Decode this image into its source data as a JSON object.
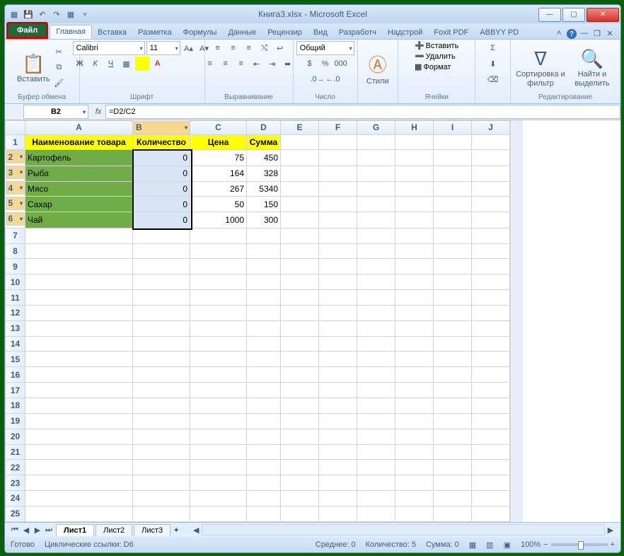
{
  "window": {
    "title": "Книга3.xlsx  -  Microsoft Excel"
  },
  "tabs": {
    "file": "Файл",
    "items": [
      "Главная",
      "Вставка",
      "Разметка",
      "Формулы",
      "Данные",
      "Рецензир",
      "Вид",
      "Разработч",
      "Надстрой",
      "Foxit PDF",
      "ABBYY PD"
    ],
    "active": 0
  },
  "ribbon": {
    "paste": "Вставить",
    "clipboard_group": "Буфер обмена",
    "font_name": "Calibri",
    "font_size": "11",
    "font_group": "Шрифт",
    "align_group": "Выравнивание",
    "number_format": "Общий",
    "number_group": "Число",
    "styles": "Стили",
    "insert": "Вставить",
    "delete": "Удалить",
    "format": "Формат",
    "cells_group": "Ячейки",
    "sort": "Сортировка и фильтр",
    "find": "Найти и выделить",
    "edit_group": "Редактирование"
  },
  "formula_bar": {
    "cell_ref": "B2",
    "formula": "=D2/C2"
  },
  "columns": [
    "A",
    "B",
    "C",
    "D",
    "E",
    "F",
    "G",
    "H",
    "I",
    "J"
  ],
  "rows_visible": 25,
  "headers": {
    "a": "Наименование товара",
    "b": "Количество",
    "c": "Цена",
    "d": "Сумма"
  },
  "data_rows": [
    {
      "name": "Картофель",
      "qty": "0",
      "price": "75",
      "sum": "450"
    },
    {
      "name": "Рыба",
      "qty": "0",
      "price": "164",
      "sum": "328"
    },
    {
      "name": "Мясо",
      "qty": "0",
      "price": "267",
      "sum": "5340"
    },
    {
      "name": "Сахар",
      "qty": "0",
      "price": "50",
      "sum": "150"
    },
    {
      "name": "Чай",
      "qty": "0",
      "price": "1000",
      "sum": "300"
    }
  ],
  "selection": {
    "range": "B2:B6"
  },
  "sheets": {
    "items": [
      "Лист1",
      "Лист2",
      "Лист3"
    ],
    "active": 0
  },
  "status": {
    "ready": "Готово",
    "circular": "Циклические ссылки: D6",
    "avg": "Среднее: 0",
    "count": "Количество: 5",
    "sum": "Сумма: 0",
    "zoom": "100%"
  }
}
